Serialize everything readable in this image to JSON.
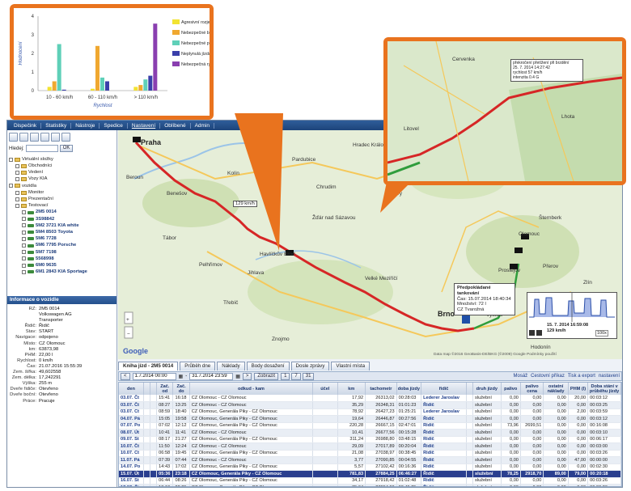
{
  "menu": [
    "Dispečink",
    "Statistiky",
    "Nástroje",
    "Spedice",
    "Nastavení",
    "Oblíbené",
    "Admin"
  ],
  "search": {
    "label": "Hledej:",
    "button": "OK"
  },
  "tree": [
    {
      "t": "Virtuální složky",
      "lvl": 0,
      "icon": "folder"
    },
    {
      "t": "Obchodníci",
      "lvl": 1,
      "icon": "folder"
    },
    {
      "t": "Vedení",
      "lvl": 1,
      "icon": "folder"
    },
    {
      "t": "Vozy KIA",
      "lvl": 1,
      "icon": "folder"
    },
    {
      "t": "vozidla",
      "lvl": 0,
      "icon": "folder"
    },
    {
      "t": "Monitor",
      "lvl": 1,
      "icon": "folder"
    },
    {
      "t": "Prezentační",
      "lvl": 1,
      "icon": "folder"
    },
    {
      "t": "Testovací",
      "lvl": 1,
      "icon": "folder"
    },
    {
      "t": "2M5 0014",
      "lvl": 2,
      "icon": "car"
    },
    {
      "t": "3S98842",
      "lvl": 2,
      "icon": "car"
    },
    {
      "t": "5M2 3721 KIA white",
      "lvl": 2,
      "icon": "car"
    },
    {
      "t": "5M4 8503 Toyota",
      "lvl": 2,
      "icon": "car"
    },
    {
      "t": "5M6 7728",
      "lvl": 2,
      "icon": "car"
    },
    {
      "t": "5M6 7795 Porsche",
      "lvl": 2,
      "icon": "car"
    },
    {
      "t": "5M7 7198",
      "lvl": 2,
      "icon": "car"
    },
    {
      "t": "5568998",
      "lvl": 2,
      "icon": "car"
    },
    {
      "t": "6M0 9635",
      "lvl": 2,
      "icon": "car"
    },
    {
      "t": "6M1 2843 KIA Sportage",
      "lvl": 2,
      "icon": "car"
    }
  ],
  "info_title": "Informace o vozidle",
  "info": [
    [
      "RZ:",
      "2M5 0014"
    ],
    [
      "",
      "Volkswagen AG"
    ],
    [
      "",
      "Transporter"
    ],
    [
      "Řidič:",
      "Řidič"
    ],
    [
      "Stav:",
      "START"
    ],
    [
      "Navigace:",
      "odpojeno"
    ],
    [
      "Místo:",
      "CZ Olomouc"
    ],
    [
      "km:",
      "63873,98"
    ],
    [
      "PHM:",
      "22,00 l"
    ],
    [
      "Rychlost:",
      "0 km/h"
    ],
    [
      "Čas:",
      "21.07.2016 15:55:39"
    ],
    [
      "Zem. šířka:",
      "49,602558"
    ],
    [
      "Zem. délka:",
      "17,242291"
    ],
    [
      "Výška:",
      "255 m"
    ],
    [
      "Dveře řidiče:",
      "Otevřeno"
    ],
    [
      "Dveře boční:",
      "Otevřeno"
    ],
    [
      "Práce:",
      "Pracuje"
    ]
  ],
  "map": {
    "cities": [
      {
        "n": "Praha",
        "big": true
      },
      {
        "n": "Beroun"
      },
      {
        "n": "Benešov"
      },
      {
        "n": "Kolín"
      },
      {
        "n": "Pardubice"
      },
      {
        "n": "Hradec Králové"
      },
      {
        "n": "Chrudim"
      },
      {
        "n": "Havlíčkův Brod"
      },
      {
        "n": "Jihlava"
      },
      {
        "n": "Třebíč"
      },
      {
        "n": "Brno",
        "big": true
      },
      {
        "n": "Olomouc"
      },
      {
        "n": "Šternberk"
      },
      {
        "n": "Přerov"
      },
      {
        "n": "Prostějov"
      },
      {
        "n": "Kroměříž"
      },
      {
        "n": "Vyškov"
      },
      {
        "n": "Hodonín"
      },
      {
        "n": "Zlín"
      },
      {
        "n": "Znojmo"
      },
      {
        "n": "Velké Meziříčí"
      },
      {
        "n": "Pelhřimov"
      },
      {
        "n": "Tábor"
      },
      {
        "n": "Žďár nad Sázavou"
      },
      {
        "n": "Svitavy"
      },
      {
        "n": "Šumperk"
      },
      {
        "n": "Uherské Hradiště"
      }
    ],
    "label_speed": "129 km/h",
    "tooltip": {
      "h": "Předpokládané tankování",
      "lines": [
        "Čas: 15.07.2014 18:40:34",
        "Množství: 72 l",
        "CZ Tvarožná"
      ]
    },
    "speed_panel": {
      "time": "15. 7. 2014 16:59:08",
      "speed": "129 km/h",
      "zoom": "100x"
    },
    "copyright": "Data map ©2016 GeoBasis-DE/BKG (©2009) Google   Podmínky použití",
    "google": "Google"
  },
  "tabs": [
    "Kniha jízd - 2M5 0014",
    "Průběh dne",
    "Náklady",
    "Body dosažení",
    "Dosle zprávy",
    "Vlastní místa"
  ],
  "filter": {
    "from": "1.7.2014 00:00",
    "to": "31.7.2014 23:59",
    "show": "Zobrazit",
    "pages": [
      "1",
      "7",
      "31"
    ],
    "actions": [
      "Mosáž",
      "Cestovní příkaz",
      "Tisk a export",
      "nastavení"
    ]
  },
  "columns": [
    "den",
    "",
    "",
    "Zač. od",
    "Zač. do",
    "odkud - kam",
    "účel",
    "km",
    "tachometr",
    "doba jízdy",
    "řidič",
    "",
    "druh jízdy",
    "palivo",
    "palivo cena",
    "ostatní náklady",
    "PHM (l)",
    "Doba stání v průběhu jízdy"
  ],
  "rows": [
    [
      "03.07. Čt",
      "",
      "",
      "15:41",
      "16:18",
      "CZ Olomouc - CZ Olomouc",
      "",
      "17,92",
      "26313,02",
      "00:28:03",
      "Lederer Jaroslav",
      "",
      "služební",
      "0,00",
      "0,00",
      "0,00",
      "20,00",
      "00:03:12"
    ],
    [
      "03.07. Čt",
      "",
      "",
      "08:27",
      "13:25",
      "CZ Olomouc - CZ Olomouc",
      "",
      "35,29",
      "26348,31",
      "01:01:23",
      "Řidič",
      "",
      "služební",
      "0,00",
      "0,00",
      "0,00",
      "0,00",
      "00:03:25"
    ],
    [
      "03.07. Čt",
      "",
      "",
      "08:59",
      "18:40",
      "CZ Olomouc, Generála Piky - CZ Olomouc",
      "",
      "78,92",
      "26427,23",
      "01:25:21",
      "Lederer Jaroslav",
      "",
      "služební",
      "0,00",
      "0,00",
      "0,00",
      "2,00",
      "00:03:59"
    ],
    [
      "04.07. Pá",
      "",
      "",
      "15:05",
      "19:58",
      "CZ Olomouc, Generála Piky - CZ Olomouc",
      "",
      "19,64",
      "26446,87",
      "00:27:56",
      "Řidič",
      "",
      "služební",
      "0,00",
      "0,00",
      "0,00",
      "0,00",
      "00:03:12"
    ],
    [
      "07.07. Po",
      "",
      "",
      "07:02",
      "12:12",
      "CZ Olomouc, Generála Piky - CZ Olomouc",
      "",
      "220,28",
      "26667,15",
      "02:47:01",
      "Řidič",
      "",
      "služební",
      "73,96",
      "2699,51",
      "0,00",
      "0,00",
      "00:16:08"
    ],
    [
      "08.07. Út",
      "",
      "",
      "10:41",
      "11:41",
      "CZ Olomouc - CZ Olomouc",
      "",
      "10,41",
      "26677,56",
      "00:15:28",
      "Řidič",
      "",
      "služební",
      "0,00",
      "0,00",
      "0,00",
      "0,00",
      "00:03:10"
    ],
    [
      "09.07. St",
      "",
      "",
      "08:17",
      "21:27",
      "CZ Olomouc, Generála Piky - CZ Olomouc",
      "",
      "311,24",
      "26988,80",
      "03:48:15",
      "Řidič",
      "",
      "služební",
      "0,00",
      "0,00",
      "0,00",
      "0,00",
      "00:06:17"
    ],
    [
      "10.07. Čt",
      "",
      "",
      "11:50",
      "12:24",
      "CZ Olomouc - CZ Olomouc",
      "",
      "29,09",
      "27017,89",
      "00:20:04",
      "Řidič",
      "",
      "služební",
      "0,00",
      "0,00",
      "0,00",
      "0,00",
      "00:03:00"
    ],
    [
      "10.07. Čt",
      "",
      "",
      "06:58",
      "19:45",
      "CZ Olomouc, Generála Piky - CZ Olomouc",
      "",
      "21,08",
      "27038,97",
      "00:38:45",
      "Řidič",
      "",
      "služební",
      "0,00",
      "0,00",
      "0,00",
      "0,00",
      "00:03:26"
    ],
    [
      "11.07. Pá",
      "",
      "",
      "07:39",
      "07:44",
      "CZ Olomouc - CZ Olomouc",
      "",
      "3,77",
      "27090,85",
      "00:04:55",
      "Řidič",
      "",
      "služební",
      "0,00",
      "0,00",
      "0,00",
      "47,00",
      "00:00:00"
    ],
    [
      "14.07. Po",
      "",
      "",
      "14:43",
      "17:02",
      "CZ Olomouc, Generála Piky - CZ Olomouc",
      "",
      "5,57",
      "27102,42",
      "00:16:36",
      "Řidič",
      "",
      "služební",
      "0,00",
      "0,00",
      "0,00",
      "0,00",
      "00:02:30"
    ],
    [
      "15.07. Út",
      "",
      "",
      "05:36",
      "23:18",
      "CZ Olomouc, Generála Piky - CZ Olomouc",
      "",
      "781,83",
      "27884,25",
      "06:46:27",
      "Řidič",
      "",
      "služební",
      "78,25",
      "2918,70",
      "89,00",
      "79,00",
      "00:20:18"
    ],
    [
      "16.07. St",
      "",
      "",
      "06:44",
      "08:26",
      "CZ Olomouc, Generála Piky - CZ Olomouc",
      "",
      "34,17",
      "27918,42",
      "01:02:48",
      "Řidič",
      "",
      "služební",
      "0,00",
      "0,00",
      "0,00",
      "0,00",
      "00:03:26"
    ],
    [
      "17.07. Čt",
      "",
      "",
      "13:18",
      "22:25",
      "CZ Olomouc, Generála Piky - CZ Olomouc",
      "",
      "35,64",
      "27954,06",
      "00:45:25",
      "Řidič",
      "",
      "služební",
      "0,00",
      "0,00",
      "0,00",
      "0,00",
      "00:03:26"
    ]
  ],
  "chart_data": {
    "type": "bar",
    "categories": [
      "10 - 60 km/h",
      "60 - 110 km/h",
      "> 110 km/h"
    ],
    "series": [
      {
        "name": "Agresivní rozjezd",
        "color": "#f2e332",
        "values": [
          0.2,
          0.1,
          0.2
        ]
      },
      {
        "name": "Nebezpečné brzdění",
        "color": "#f0a830",
        "values": [
          0.5,
          2.4,
          0.3
        ]
      },
      {
        "name": "Nebezpečné průjezdy zatáčkou",
        "color": "#5fd0b8",
        "values": [
          2.5,
          0.7,
          0.6
        ]
      },
      {
        "name": "Neplynulá jízda",
        "color": "#3a3faa",
        "values": [
          0.05,
          0.5,
          0.8
        ]
      },
      {
        "name": "Nebezpečná rychlost",
        "color": "#8a3fb0",
        "values": [
          0,
          0,
          3.6
        ]
      }
    ],
    "xlabel": "Rychlost",
    "ylabel": "Hodnocení",
    "ylim": [
      0,
      4
    ],
    "yticks": [
      0,
      1,
      2,
      3,
      4
    ],
    "legend": "right"
  },
  "mini_map": {
    "tooltip": [
      "překročení přetížení při brzdění",
      "25. 7. 2014 14:27:42",
      "rychlost 57 km/h",
      "intenzita 0.4 G"
    ],
    "places": [
      "Cervenka",
      "Litovel",
      "Lhota"
    ]
  }
}
